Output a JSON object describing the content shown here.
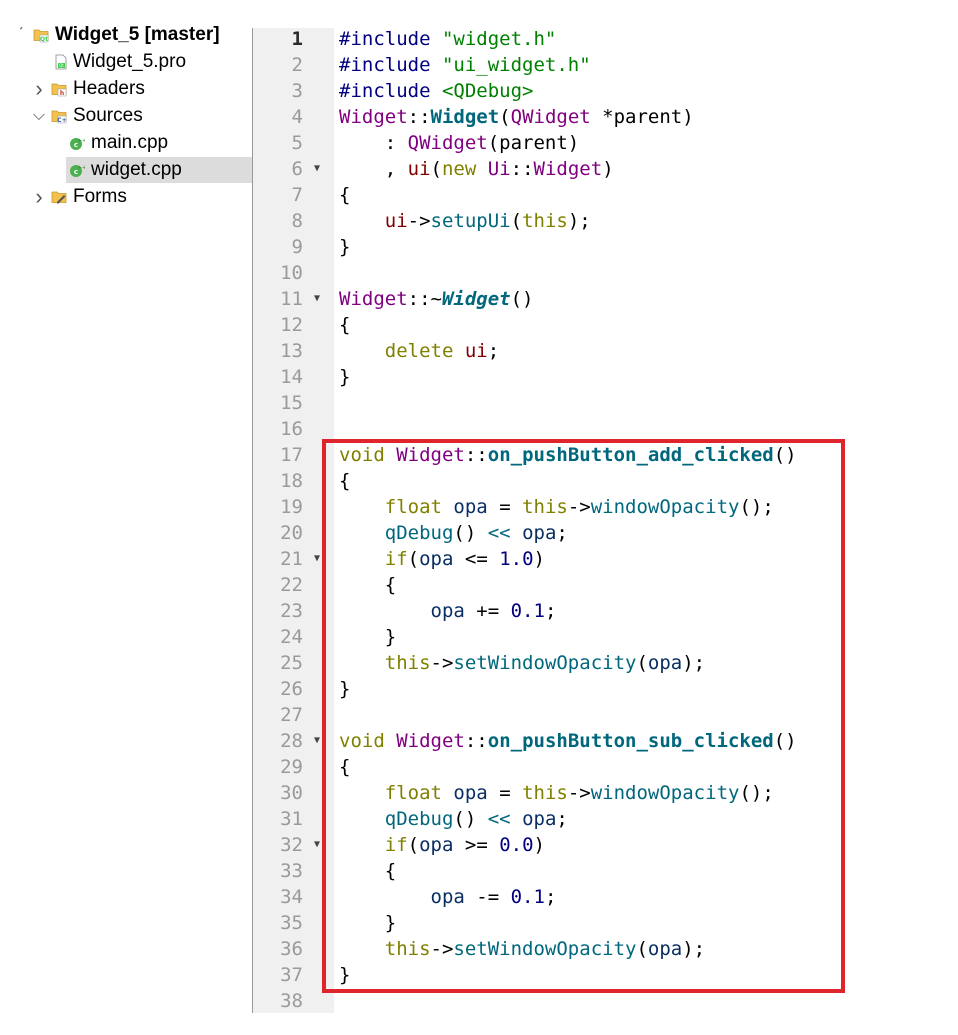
{
  "project_tree": {
    "items": [
      {
        "label": "Widget_5 [master]",
        "icon": "qt-project-folder-icon",
        "arrow": "expanded",
        "bold": true
      },
      {
        "label": "Widget_5.pro",
        "icon": "pro-file-icon",
        "arrow": "",
        "bold": false
      },
      {
        "label": "Headers",
        "icon": "headers-folder-icon",
        "arrow": "collapsed",
        "bold": false
      },
      {
        "label": "Sources",
        "icon": "sources-folder-icon",
        "arrow": "expanded",
        "bold": false
      },
      {
        "label": "main.cpp",
        "icon": "cpp-file-icon",
        "arrow": "",
        "bold": false
      },
      {
        "label": "widget.cpp",
        "icon": "cpp-file-icon",
        "arrow": "",
        "bold": false,
        "selected": true
      },
      {
        "label": "Forms",
        "icon": "forms-folder-icon",
        "arrow": "collapsed",
        "bold": false
      }
    ]
  },
  "editor": {
    "current_line": 1,
    "fold_markers": [
      6,
      11,
      21,
      28,
      32
    ],
    "highlight_box_color": "#e0242c",
    "lines": [
      [
        [
          "pre",
          "#include "
        ],
        [
          "str",
          "\"widget.h\""
        ]
      ],
      [
        [
          "pre",
          "#include "
        ],
        [
          "str",
          "\"ui_widget.h\""
        ]
      ],
      [
        [
          "pre",
          "#include "
        ],
        [
          "str",
          "<QDebug>"
        ]
      ],
      [
        [
          "type",
          "Widget"
        ],
        [
          "def",
          "::"
        ],
        [
          "decl",
          "Widget"
        ],
        [
          "def",
          "("
        ],
        [
          "type",
          "QWidget"
        ],
        [
          "def",
          " *parent)"
        ]
      ],
      [
        [
          "def",
          "    : "
        ],
        [
          "type",
          "QWidget"
        ],
        [
          "def",
          "(parent)"
        ]
      ],
      [
        [
          "def",
          "    , "
        ],
        [
          "memb",
          "ui"
        ],
        [
          "def",
          "("
        ],
        [
          "kw",
          "new"
        ],
        [
          "def",
          " "
        ],
        [
          "type",
          "Ui"
        ],
        [
          "def",
          "::"
        ],
        [
          "type",
          "Widget"
        ],
        [
          "def",
          ")"
        ]
      ],
      [
        [
          "def",
          "{"
        ]
      ],
      [
        [
          "def",
          "    "
        ],
        [
          "memb",
          "ui"
        ],
        [
          "def",
          "->"
        ],
        [
          "fn",
          "setupUi"
        ],
        [
          "def",
          "("
        ],
        [
          "kw",
          "this"
        ],
        [
          "def",
          ");"
        ]
      ],
      [
        [
          "def",
          "}"
        ]
      ],
      [],
      [
        [
          "type",
          "Widget"
        ],
        [
          "def",
          "::~"
        ],
        [
          "ital",
          "Widget"
        ],
        [
          "def",
          "()"
        ]
      ],
      [
        [
          "def",
          "{"
        ]
      ],
      [
        [
          "def",
          "    "
        ],
        [
          "kw",
          "delete"
        ],
        [
          "def",
          " "
        ],
        [
          "memb",
          "ui"
        ],
        [
          "def",
          ";"
        ]
      ],
      [
        [
          "def",
          "}"
        ]
      ],
      [],
      [],
      [
        [
          "kw",
          "void"
        ],
        [
          "def",
          " "
        ],
        [
          "type",
          "Widget"
        ],
        [
          "def",
          "::"
        ],
        [
          "decl",
          "on_pushButton_add_clicked"
        ],
        [
          "def",
          "()"
        ]
      ],
      [
        [
          "def",
          "{"
        ]
      ],
      [
        [
          "def",
          "    "
        ],
        [
          "kw",
          "float"
        ],
        [
          "def",
          " "
        ],
        [
          "var",
          "opa"
        ],
        [
          "def",
          " = "
        ],
        [
          "kw",
          "this"
        ],
        [
          "def",
          "->"
        ],
        [
          "fn",
          "windowOpacity"
        ],
        [
          "def",
          "();"
        ]
      ],
      [
        [
          "def",
          "    "
        ],
        [
          "fn",
          "qDebug"
        ],
        [
          "def",
          "() "
        ],
        [
          "fn",
          "<<"
        ],
        [
          "def",
          " "
        ],
        [
          "var",
          "opa"
        ],
        [
          "def",
          ";"
        ]
      ],
      [
        [
          "def",
          "    "
        ],
        [
          "kw",
          "if"
        ],
        [
          "def",
          "("
        ],
        [
          "var",
          "opa"
        ],
        [
          "def",
          " <= "
        ],
        [
          "num",
          "1.0"
        ],
        [
          "def",
          ")"
        ]
      ],
      [
        [
          "def",
          "    {"
        ]
      ],
      [
        [
          "def",
          "        "
        ],
        [
          "var",
          "opa"
        ],
        [
          "def",
          " += "
        ],
        [
          "num",
          "0.1"
        ],
        [
          "def",
          ";"
        ]
      ],
      [
        [
          "def",
          "    }"
        ]
      ],
      [
        [
          "def",
          "    "
        ],
        [
          "kw",
          "this"
        ],
        [
          "def",
          "->"
        ],
        [
          "fn",
          "setWindowOpacity"
        ],
        [
          "def",
          "("
        ],
        [
          "var",
          "opa"
        ],
        [
          "def",
          ");"
        ]
      ],
      [
        [
          "def",
          "}"
        ]
      ],
      [],
      [
        [
          "kw",
          "void"
        ],
        [
          "def",
          " "
        ],
        [
          "type",
          "Widget"
        ],
        [
          "def",
          "::"
        ],
        [
          "decl",
          "on_pushButton_sub_clicked"
        ],
        [
          "def",
          "()"
        ]
      ],
      [
        [
          "def",
          "{"
        ]
      ],
      [
        [
          "def",
          "    "
        ],
        [
          "kw",
          "float"
        ],
        [
          "def",
          " "
        ],
        [
          "var",
          "opa"
        ],
        [
          "def",
          " = "
        ],
        [
          "kw",
          "this"
        ],
        [
          "def",
          "->"
        ],
        [
          "fn",
          "windowOpacity"
        ],
        [
          "def",
          "();"
        ]
      ],
      [
        [
          "def",
          "    "
        ],
        [
          "fn",
          "qDebug"
        ],
        [
          "def",
          "() "
        ],
        [
          "fn",
          "<<"
        ],
        [
          "def",
          " "
        ],
        [
          "var",
          "opa"
        ],
        [
          "def",
          ";"
        ]
      ],
      [
        [
          "def",
          "    "
        ],
        [
          "kw",
          "if"
        ],
        [
          "def",
          "("
        ],
        [
          "var",
          "opa"
        ],
        [
          "def",
          " >= "
        ],
        [
          "num",
          "0.0"
        ],
        [
          "def",
          ")"
        ]
      ],
      [
        [
          "def",
          "    {"
        ]
      ],
      [
        [
          "def",
          "        "
        ],
        [
          "var",
          "opa"
        ],
        [
          "def",
          " -= "
        ],
        [
          "num",
          "0.1"
        ],
        [
          "def",
          ";"
        ]
      ],
      [
        [
          "def",
          "    }"
        ]
      ],
      [
        [
          "def",
          "    "
        ],
        [
          "kw",
          "this"
        ],
        [
          "def",
          "->"
        ],
        [
          "fn",
          "setWindowOpacity"
        ],
        [
          "def",
          "("
        ],
        [
          "var",
          "opa"
        ],
        [
          "def",
          ");"
        ]
      ],
      [
        [
          "def",
          "}"
        ]
      ],
      []
    ]
  }
}
